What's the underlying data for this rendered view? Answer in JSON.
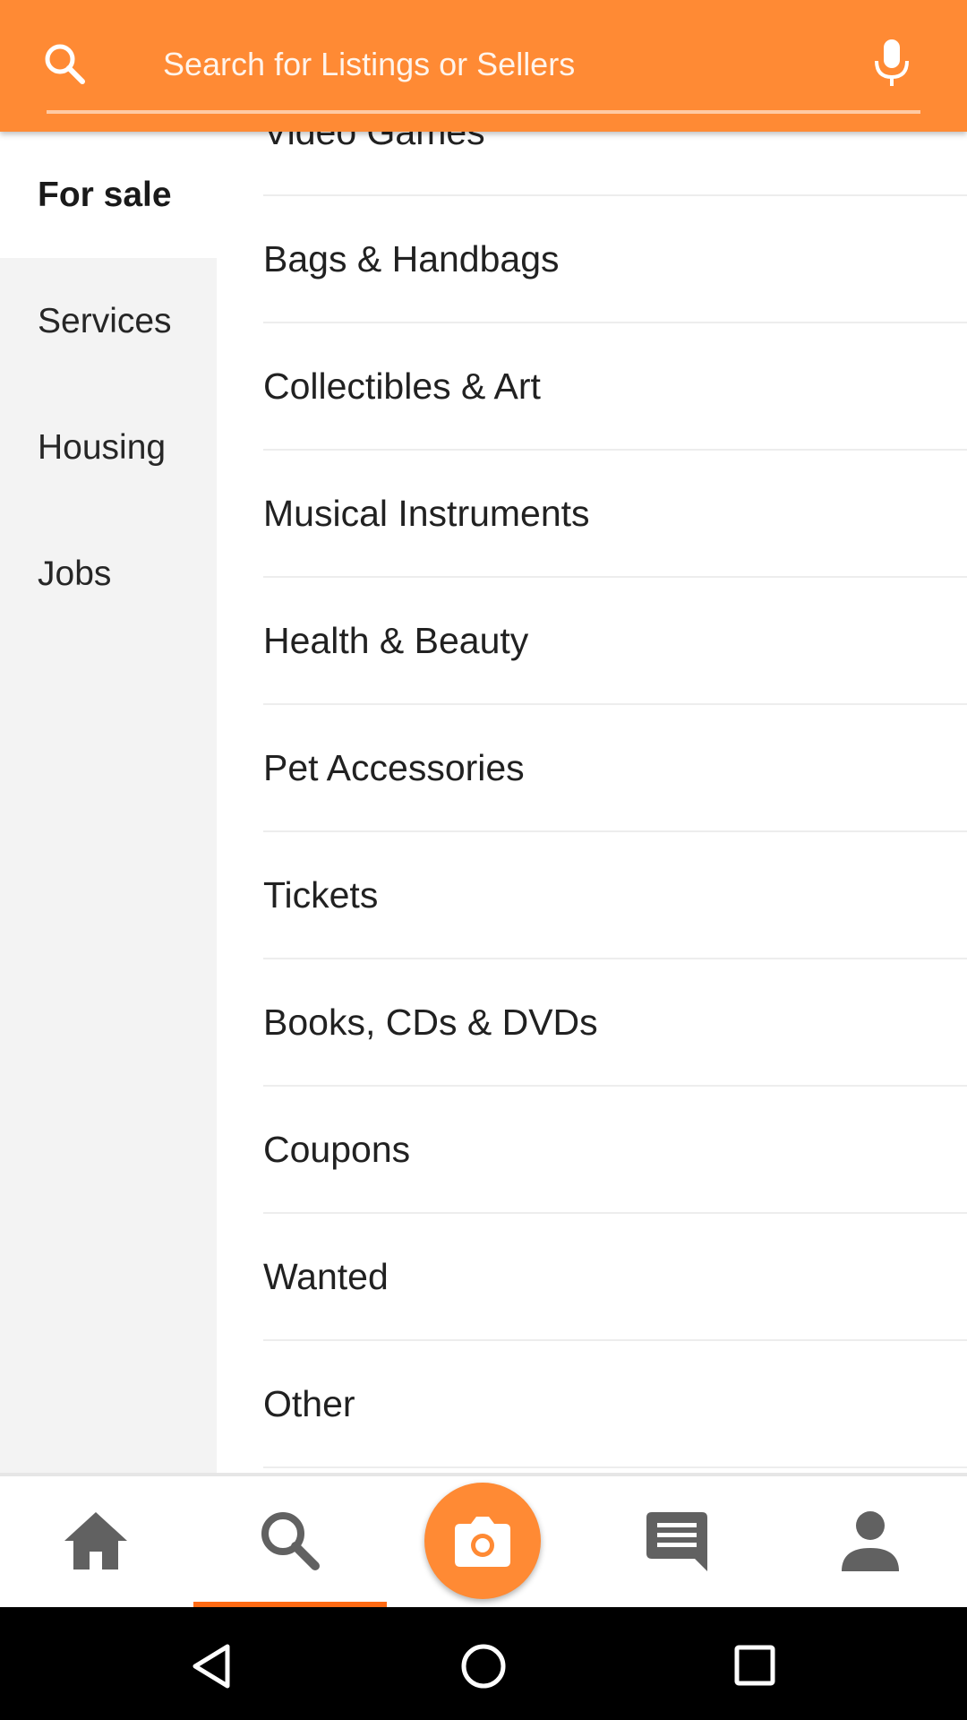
{
  "search": {
    "placeholder": "Search for Listings or Sellers",
    "value": ""
  },
  "sidebar": {
    "items": [
      {
        "label": "For sale",
        "active": true
      },
      {
        "label": "Services",
        "active": false
      },
      {
        "label": "Housing",
        "active": false
      },
      {
        "label": "Jobs",
        "active": false
      }
    ]
  },
  "subcategories": {
    "items": [
      {
        "label": "Video Games"
      },
      {
        "label": "Bags & Handbags"
      },
      {
        "label": "Collectibles & Art"
      },
      {
        "label": "Musical Instruments"
      },
      {
        "label": "Health & Beauty"
      },
      {
        "label": "Pet Accessories"
      },
      {
        "label": "Tickets"
      },
      {
        "label": "Books, CDs & DVDs"
      },
      {
        "label": "Coupons"
      },
      {
        "label": "Wanted"
      },
      {
        "label": "Other"
      }
    ]
  },
  "bottom_nav": {
    "items": [
      {
        "icon": "home-icon",
        "selected": false
      },
      {
        "icon": "search-icon",
        "selected": true
      },
      {
        "icon": "camera-icon",
        "selected": false
      },
      {
        "icon": "chat-icon",
        "selected": false
      },
      {
        "icon": "profile-icon",
        "selected": false
      }
    ]
  },
  "system_nav": {
    "icons": [
      "back-icon",
      "home-circle-icon",
      "recents-icon"
    ]
  },
  "colors": {
    "brand_orange": "#FF8A34",
    "nav_indicator": "#FF6A13",
    "sidebar_bg": "#F3F3F3",
    "nav_icon_gray": "#616161"
  }
}
